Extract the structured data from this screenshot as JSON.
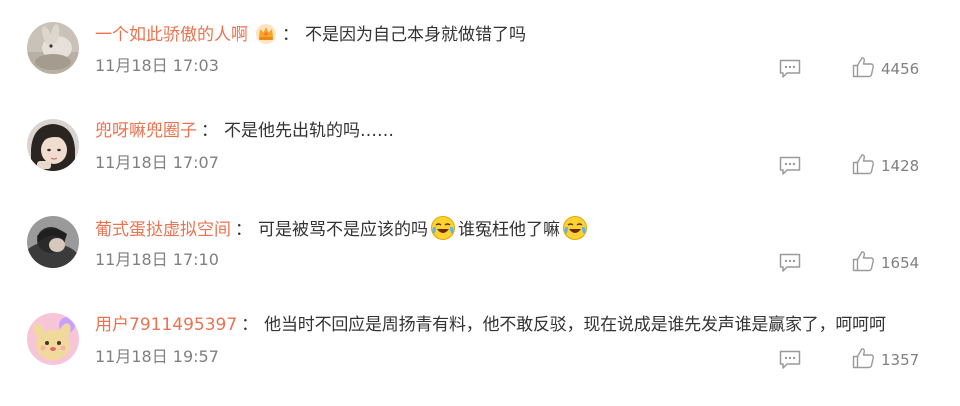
{
  "comments": [
    {
      "username": "一个如此骄傲的人啊",
      "badge": "crown-badge-icon",
      "separator": "：",
      "text_parts": [
        "不是因为自己本身就做错了吗"
      ],
      "time": "11月18日 17:03",
      "likes": "4456",
      "avatar": "rabbit-avatar"
    },
    {
      "username": "兜呀嘛兜圈子",
      "separator": "：",
      "text_parts": [
        "不是他先出轨的吗……"
      ],
      "time": "11月18日 17:07",
      "likes": "1428",
      "avatar": "girl-avatar"
    },
    {
      "username": "葡式蛋挞虚拟空间",
      "separator": "：",
      "text_parts": [
        "可是被骂不是应该的吗",
        "谁冤枉他了嘛"
      ],
      "emoji": "crying-laughing-emoji",
      "time": "11月18日 17:10",
      "likes": "1654",
      "avatar": "person-avatar"
    },
    {
      "username": "用户7911495397",
      "separator": "：",
      "text_parts": [
        "他当时不回应是周扬青有料，他不敢反驳，现在说成是谁先发声谁是赢家了，呵呵呵"
      ],
      "time": "11月18日 19:57",
      "likes": "1357",
      "avatar": "cartoon-avatar"
    }
  ],
  "colors": {
    "username": "#eb7350",
    "text": "#333333",
    "meta": "#808080",
    "icon": "#9a9a9a"
  }
}
